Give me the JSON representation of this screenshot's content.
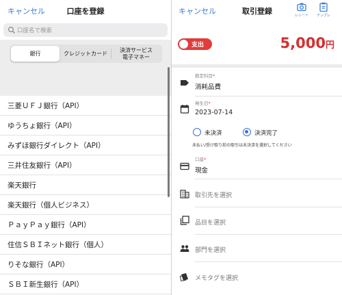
{
  "left": {
    "cancel": "キャンセル",
    "title": "口座を登録",
    "search_placeholder": "口座名で検索",
    "segments": [
      "銀行",
      "クレジットカード",
      "決済サービス\n電子マネー"
    ],
    "banks": [
      "三菱ＵＦＪ銀行（API）",
      "ゆうちょ銀行（API）",
      "みずほ銀行ダイレクト（API）",
      "三井住友銀行（API）",
      "楽天銀行",
      "楽天銀行（個人ビジネス）",
      "ＰａｙＰａｙ銀行（API）",
      "住信ＳＢＩネット銀行（個人）",
      "りそな銀行（API）",
      "ＳＢＩ新生銀行（API）"
    ]
  },
  "right": {
    "cancel": "キャンセル",
    "title": "取引登録",
    "receipt_label": "レシート",
    "template_label": "テンプレ",
    "type_toggle": "支出",
    "amount": "5,000",
    "currency": "円",
    "account_title_label": "勘定科目",
    "account_title_value": "消耗品費",
    "date_label": "発生日",
    "date_value": "2023-07-14",
    "status_unsettled": "未決済",
    "status_settled": "決済完了",
    "status_note": "未払い/受け取り前の取引は未決済を選択してください",
    "account_label": "口座",
    "account_value": "現金",
    "partner_placeholder": "取引先を選択",
    "item_placeholder": "品目を選択",
    "department_placeholder": "部門を選択",
    "memo_tag_placeholder": "メモタグを選択",
    "required_mark": "*"
  }
}
